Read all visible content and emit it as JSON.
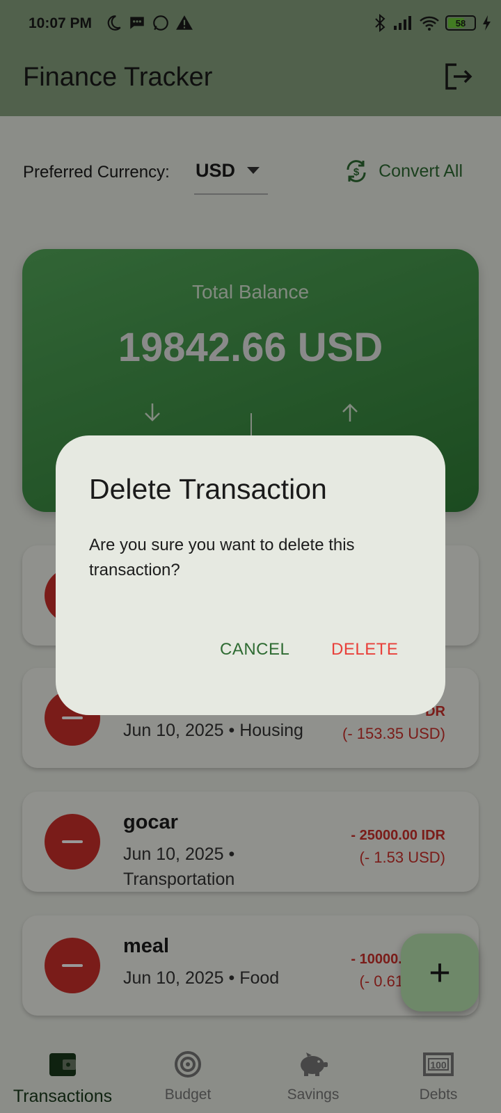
{
  "status_bar": {
    "time": "10:07 PM",
    "battery": "58"
  },
  "app_bar": {
    "title": "Finance Tracker"
  },
  "currency": {
    "label": "Preferred Currency:",
    "value": "USD",
    "convert_label": "Convert All"
  },
  "balance": {
    "label": "Total Balance",
    "amount": "19842.66 USD"
  },
  "transactions": [
    {
      "name": "",
      "meta": "",
      "amount": "",
      "converted": ""
    },
    {
      "name": "",
      "meta": "Jun 10, 2025 • Housing",
      "amount": "DR",
      "converted": "(- 153.35 USD)"
    },
    {
      "name": "gocar",
      "meta": "Jun 10, 2025 • Transportation",
      "amount": "- 25000.00 IDR",
      "converted": "(- 1.53 USD)"
    },
    {
      "name": "meal",
      "meta": "Jun 10, 2025 • Food",
      "amount": "- 10000.00 IDR",
      "converted": "(- 0.61 USD)"
    }
  ],
  "fab": {
    "label": "+"
  },
  "nav": [
    {
      "label": "Transactions",
      "icon": "wallet-icon",
      "active": true
    },
    {
      "label": "Budget",
      "icon": "target-icon",
      "active": false
    },
    {
      "label": "Savings",
      "icon": "piggy-bank-icon",
      "active": false
    },
    {
      "label": "Debts",
      "icon": "money-bill-icon",
      "active": false
    }
  ],
  "dialog": {
    "title": "Delete Transaction",
    "message": "Are you sure you want to delete this transaction?",
    "cancel_label": "CANCEL",
    "delete_label": "DELETE"
  },
  "colors": {
    "appbar": "#88a27f",
    "card_green": "#3f9147",
    "expense_red": "#cc2f2a",
    "delete_red": "#e8403a",
    "accent_green": "#2e6b32"
  }
}
